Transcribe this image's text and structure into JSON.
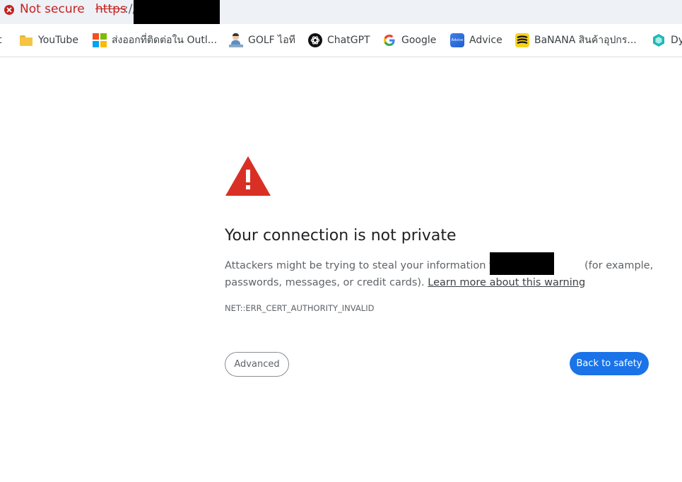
{
  "address_bar": {
    "security_label": "Not secure",
    "url_scheme": "https",
    "url_rest": "://",
    "security_color": "#c5221f"
  },
  "bookmarks": [
    {
      "label": "t",
      "icon": "folder-icon"
    },
    {
      "label": "YouTube",
      "icon": "folder-icon"
    },
    {
      "label": "ส่งออกที่ติดต่อใน Outl...",
      "icon": "microsoft-icon"
    },
    {
      "label": "GOLF ไอที",
      "icon": "golf-avatar-icon"
    },
    {
      "label": "ChatGPT",
      "icon": "chatgpt-icon"
    },
    {
      "label": "Google",
      "icon": "google-icon"
    },
    {
      "label": "Advice",
      "icon": "advice-icon"
    },
    {
      "label": "BaNANA สินค้าอุปกร...",
      "icon": "banana-icon"
    },
    {
      "label": "Dy",
      "icon": "dynamics-icon"
    }
  ],
  "advice_icon_text": "Advice",
  "main": {
    "title": "Your connection is not private",
    "desc_part1": "Attackers might be trying to steal your information from",
    "desc_part2": "(for example,",
    "desc_part3": "passwords, messages, or credit cards).",
    "learn_more": "Learn more about this warning",
    "error_code": "NET::ERR_CERT_AUTHORITY_INVALID",
    "advanced_label": "Advanced",
    "back_label": "Back to safety",
    "warning_color": "#d93025",
    "primary_color": "#1a73e8"
  }
}
